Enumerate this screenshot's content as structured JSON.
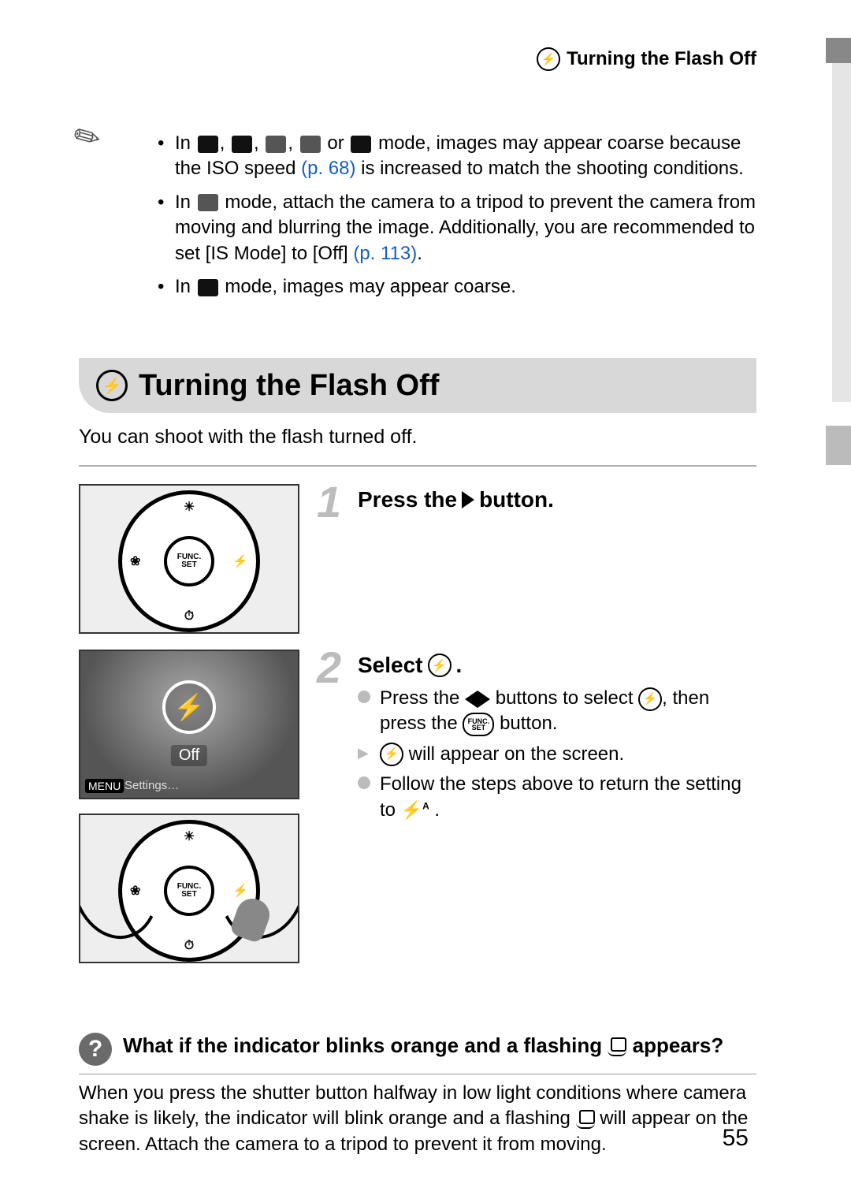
{
  "header": {
    "title": "Turning the Flash Off"
  },
  "notes": {
    "b1a": "In ",
    "b1b": " mode, images may appear coarse because the ISO speed ",
    "b1_link": "(p. 68)",
    "b1c": " is increased to match the shooting conditions.",
    "b2a": "In ",
    "b2b": " mode, attach the camera to a tripod to prevent the camera from moving and blurring the image. Additionally, you are recommended to set [IS Mode] to [Off] ",
    "b2_link": "(p. 113)",
    "b2c": ".",
    "b3a": "In ",
    "b3b": " mode, images may appear coarse."
  },
  "section": {
    "title": "Turning the Flash Off"
  },
  "intro": "You can shoot with the flash turned off.",
  "step1": {
    "num": "1",
    "title_a": "Press the ",
    "title_b": " button."
  },
  "step2": {
    "num": "2",
    "title_a": "Select ",
    "l1a": "Press the ",
    "l1b": " buttons to select ",
    "l1c": ", then press the ",
    "l1d": " button.",
    "l2b": " will appear on the screen.",
    "l3a": "Follow the steps above to return the setting to ",
    "func_top": "FUNC.",
    "func_bot": "SET"
  },
  "lcd": {
    "off": "Off",
    "menu": "MENU",
    "settings": "Settings…"
  },
  "dial": {
    "func_top": "FUNC.",
    "func_bot": "SET",
    "right": "⚡",
    "left": "❀",
    "top": "☀",
    "bot": "⏱"
  },
  "tip": {
    "q": "?",
    "title_a": "What if the indicator blinks orange and a flashing ",
    "title_b": " appears?",
    "body_a": "When you press the shutter button halfway in low light conditions where camera shake is likely, the indicator will blink orange and a flashing ",
    "body_b": " will appear on the screen. Attach the camera to a tripod to prevent it from moving."
  },
  "page": "55"
}
